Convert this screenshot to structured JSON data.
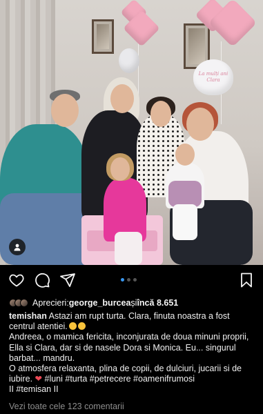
{
  "post": {
    "photo_description_alt": "",
    "balloon_text": "La mulți ani Clara",
    "carousel": {
      "count": 3,
      "active_index": 0
    }
  },
  "actions": {
    "like": "heart-outline-icon",
    "comment": "comment-icon",
    "share": "paper-plane-icon",
    "save": "bookmark-icon"
  },
  "likes": {
    "prefix": "Aprecieri: ",
    "user": "george_burcea",
    "middle": " și ",
    "count_text": "încă 8.651"
  },
  "caption": {
    "username": "temishan",
    "line1": " Astazi am rupt turta. Clara, finuta noastra a fost centrul atentiei.",
    "line2": "Andreea, o mamica fericita, inconjurata de doua minuni proprii, Ella si Clara, dar si de nasele Dora si Monica. Eu... singurul barbat... mandru.",
    "line3": "O atmosfera relaxanta, plina de copii, de dulciuri, jucarii si de iubire. ",
    "hashtags": " #luni #turta #petrecere #oamenifrumosi",
    "line4": "II #temisan II"
  },
  "comments": {
    "link_text": "Vezi toate cele 123 comentarii"
  },
  "colors": {
    "background": "#000000",
    "text": "#f5f5f5",
    "muted": "#8e8e8e",
    "carousel_active": "#3897f0",
    "heart": "#ed4956"
  }
}
